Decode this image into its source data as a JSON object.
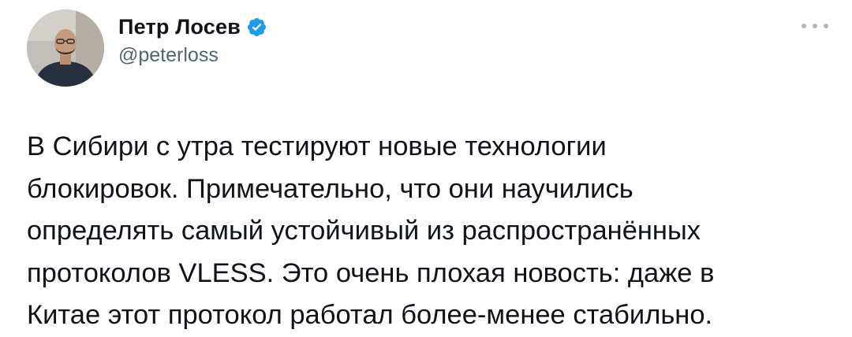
{
  "author": {
    "display_name": "Петр Лосев",
    "handle": "@peterloss",
    "verified": true
  },
  "icons": {
    "verified": "verified-badge-icon",
    "more": "more-options-icon"
  },
  "colors": {
    "verified_badge": "#1d9bf0",
    "text": "#0f1419",
    "secondary_text": "#536471"
  },
  "tweet": {
    "lines": [
      "В Сибири с утра тестируют новые технологии",
      "блокировок. Примечательно, что они научились",
      "определять самый устойчивый из распространённых",
      "протоколов VLESS. Это очень плохая новость: даже в",
      "Китае этот протокол работал более-менее стабильно."
    ]
  }
}
